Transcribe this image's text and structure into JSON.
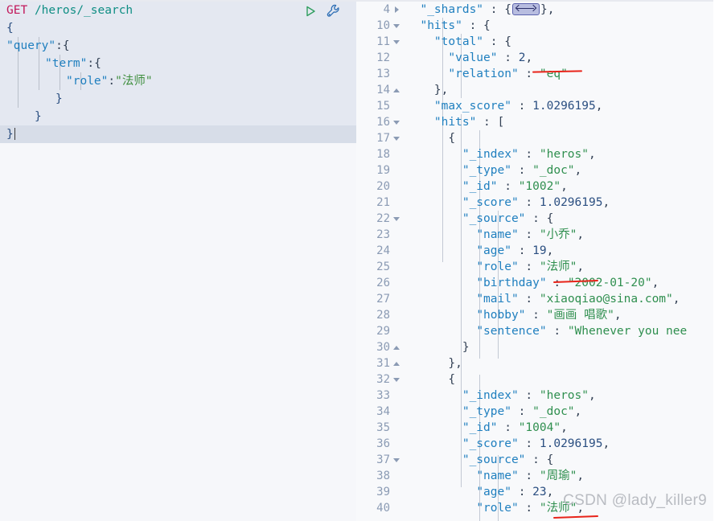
{
  "request": {
    "method": "GET",
    "path": "/heros/_search",
    "actions": [
      {
        "name": "run-request-button",
        "icon": "play-icon",
        "title": "Click to send request"
      },
      {
        "name": "request-options-button",
        "icon": "wrench-icon",
        "title": "Request options"
      }
    ],
    "lines": [
      {
        "n": 1,
        "text": "{"
      },
      {
        "n": 2,
        "text": "  \"query\":{"
      },
      {
        "n": 3,
        "text": "      \"term\":{"
      },
      {
        "n": 4,
        "text": "        \"role\":\"法师\""
      },
      {
        "n": 5,
        "text": "      }"
      },
      {
        "n": 6,
        "text": "  }"
      },
      {
        "n": 7,
        "text": "}"
      }
    ],
    "query_key": "\"query\"",
    "term_key": "\"term\"",
    "role_key": "\"role\"",
    "role_value": "\"法师\""
  },
  "response": {
    "lines": [
      {
        "no": "4",
        "fold": "right",
        "text": "  \"_shards\" : {",
        "tail": "},",
        "widget": "fold-placeholder"
      },
      {
        "no": "10",
        "fold": "down",
        "text": "  \"hits\" : {"
      },
      {
        "no": "11",
        "fold": "down",
        "text": "    \"total\" : {"
      },
      {
        "no": "12",
        "fold": "",
        "text": "      \"value\" : 2,"
      },
      {
        "no": "13",
        "fold": "",
        "text": "      \"relation\" : \"eq\""
      },
      {
        "no": "14",
        "fold": "up",
        "text": "    },"
      },
      {
        "no": "15",
        "fold": "",
        "text": "    \"max_score\" : 1.0296195,"
      },
      {
        "no": "16",
        "fold": "down",
        "text": "    \"hits\" : ["
      },
      {
        "no": "17",
        "fold": "down",
        "text": "      {"
      },
      {
        "no": "18",
        "fold": "",
        "text": "        \"_index\" : \"heros\","
      },
      {
        "no": "19",
        "fold": "",
        "text": "        \"_type\" : \"_doc\","
      },
      {
        "no": "20",
        "fold": "",
        "text": "        \"_id\" : \"1002\","
      },
      {
        "no": "21",
        "fold": "",
        "text": "        \"_score\" : 1.0296195,"
      },
      {
        "no": "22",
        "fold": "down",
        "text": "        \"_source\" : {"
      },
      {
        "no": "23",
        "fold": "",
        "text": "          \"name\" : \"小乔\","
      },
      {
        "no": "24",
        "fold": "",
        "text": "          \"age\" : 19,"
      },
      {
        "no": "25",
        "fold": "",
        "text": "          \"role\" : \"法师\","
      },
      {
        "no": "26",
        "fold": "",
        "text": "          \"birthday\" : \"2002-01-20\","
      },
      {
        "no": "27",
        "fold": "",
        "text": "          \"mail\" : \"xiaoqiao@sina.com\","
      },
      {
        "no": "28",
        "fold": "",
        "text": "          \"hobby\" : \"画画 唱歌\","
      },
      {
        "no": "29",
        "fold": "",
        "text": "          \"sentence\" : \"Whenever you nee"
      },
      {
        "no": "30",
        "fold": "up",
        "text": "        }"
      },
      {
        "no": "31",
        "fold": "up",
        "text": "      },"
      },
      {
        "no": "32",
        "fold": "down",
        "text": "      {"
      },
      {
        "no": "33",
        "fold": "",
        "text": "        \"_index\" : \"heros\","
      },
      {
        "no": "34",
        "fold": "",
        "text": "        \"_type\" : \"_doc\","
      },
      {
        "no": "35",
        "fold": "",
        "text": "        \"_id\" : \"1004\","
      },
      {
        "no": "36",
        "fold": "",
        "text": "        \"_score\" : 1.0296195,"
      },
      {
        "no": "37",
        "fold": "down",
        "text": "        \"_source\" : {"
      },
      {
        "no": "38",
        "fold": "",
        "text": "          \"name\" : \"周瑜\","
      },
      {
        "no": "39",
        "fold": "",
        "text": "          \"age\" : 23,"
      },
      {
        "no": "40",
        "fold": "",
        "text": "          \"role\" : \"法师\","
      }
    ],
    "total_value": "2",
    "total_relation": "eq",
    "max_score": "1.0296195",
    "hit_ids": [
      "1002",
      "1004"
    ],
    "hit_names": [
      "小乔",
      "周瑜"
    ]
  },
  "annotations": {
    "underline_count": "3",
    "underlined_values": [
      "2,",
      "法师",
      "法师"
    ]
  },
  "watermark": "CSDN @lady_killer9",
  "colors": {
    "method": "#c2185b",
    "path": "#0f8e84",
    "key": "#1f7fbf",
    "string": "#2f8f4f",
    "annotation": "#e8241a",
    "request_bg": "#e4e8f1",
    "current_line": "#d7dde8"
  },
  "splitter": {
    "name": "pane-splitter"
  }
}
